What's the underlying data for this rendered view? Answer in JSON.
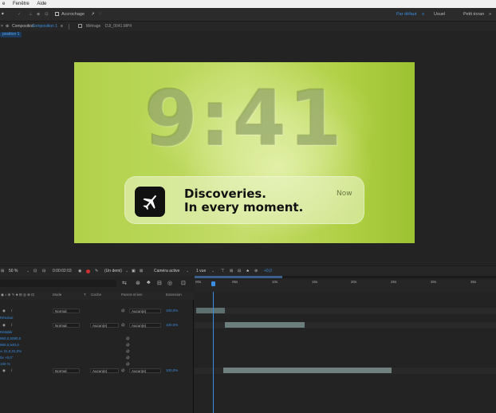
{
  "menubar": {
    "items": [
      "e",
      "Fenêtre",
      "Aide"
    ]
  },
  "toolbar": {
    "snap_label": "Accrochage",
    "workspace_default": "Par défaut",
    "workspace_menu": "≡",
    "workspace_usual": "Usuel",
    "workspace_small": "Petit écran",
    "menu_more": "»"
  },
  "panels": {
    "comp_tab": "Composition",
    "comp_tab_name": "Composition 1",
    "footage_tab_prefix": "Métrage",
    "footage_tab_name": "DJI_0041.MP4",
    "subtab": "position 1"
  },
  "comp": {
    "clock": "9:41",
    "notif_title": "Discoveries.",
    "notif_sub": "In every moment.",
    "notif_time": "Now"
  },
  "viewerbar": {
    "zoom": "50 %",
    "timecode": "0:00:02:03",
    "resolution": "(Un demi)",
    "camera": "Caméra active",
    "views": "1 vue",
    "plus": "+0,0"
  },
  "timeline": {
    "ruler": [
      "00s",
      "05s",
      "10s",
      "15s",
      "20s",
      "25s",
      "30s",
      "35s"
    ],
    "headers": {
      "mode": "Mode",
      "t": "T",
      "cache": "Cache",
      "parent": "Parent et lien",
      "stretch": "Extension"
    },
    "rows": [
      {
        "label": "",
        "mode": "Normal",
        "cache": "",
        "parent": "Aucun(e)",
        "stretch": "100,0%"
      },
      {
        "label": "Résolue",
        "mode": "",
        "cache": "",
        "parent": "",
        "stretch": ""
      },
      {
        "label": "",
        "mode": "Normal",
        "cache": "Aucun(e)",
        "parent": "Aucun(e)",
        "stretch": "100,0%"
      },
      {
        "label": "Rétablir",
        "mode": "",
        "cache": "",
        "parent": "",
        "stretch": ""
      },
      {
        "label": "960,0,5080,0",
        "mode": "",
        "cache": "",
        "parent": "",
        "stretch": ""
      },
      {
        "label": "960,0,540,0",
        "mode": "",
        "cache": "",
        "parent": "",
        "stretch": ""
      },
      {
        "label": "∞ 31,0,31,0%",
        "mode": "",
        "cache": "",
        "parent": "",
        "stretch": ""
      },
      {
        "label": "0x +0,0°",
        "mode": "",
        "cache": "",
        "parent": "",
        "stretch": ""
      },
      {
        "label": "100 %",
        "mode": "",
        "cache": "",
        "parent": "",
        "stretch": ""
      },
      {
        "label": "",
        "mode": "Normal",
        "cache": "Aucun(e)",
        "parent": "Aucun(e)",
        "stretch": "100,0%"
      }
    ]
  },
  "colors": {
    "accent": "#3a8de0",
    "comp_green": "#b9d657",
    "panel": "#232323"
  }
}
